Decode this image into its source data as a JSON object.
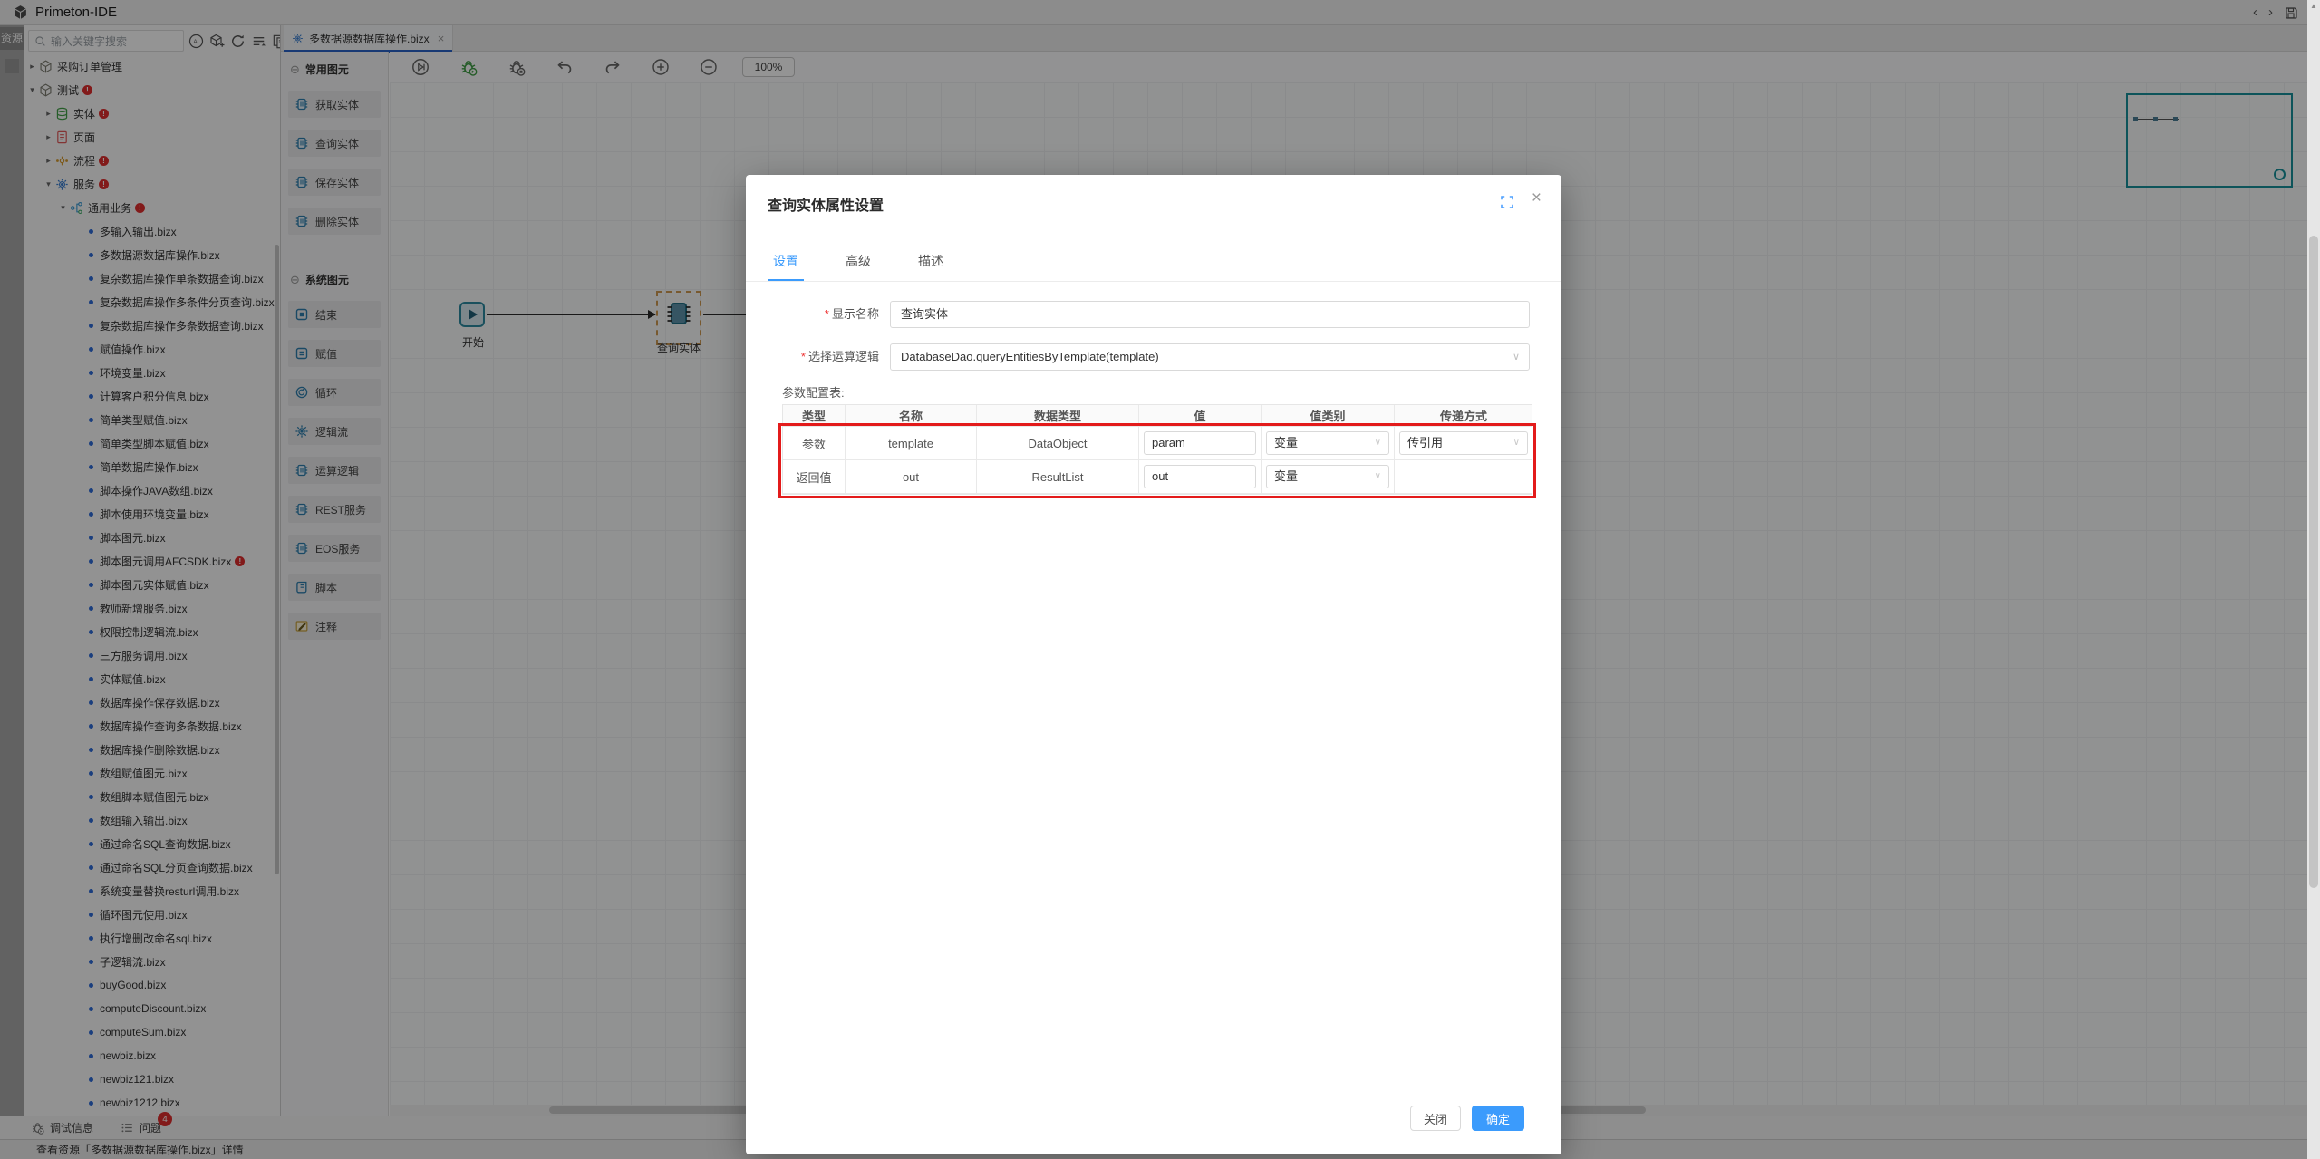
{
  "colors": {
    "accent_blue": "#3b9bfc",
    "danger_red": "#e02d2d",
    "highlight_red": "#e31b1b",
    "teal": "#18929b",
    "file_dot_blue": "#2e6cd9",
    "tab_underline_blue": "#2a62c9"
  },
  "app": {
    "title": "Primeton-IDE"
  },
  "window_controls": [
    "back",
    "forward",
    "save"
  ],
  "activity_bar": {
    "label": "资源"
  },
  "explorer": {
    "search": {
      "placeholder": "输入关键字搜索",
      "icons": [
        "ai",
        "new-model",
        "refresh",
        "outline",
        "documents"
      ]
    },
    "tree": [
      {
        "indent": 0,
        "expanded": false,
        "icon": "package",
        "label": "采购订单管理",
        "badge": false
      },
      {
        "indent": 0,
        "expanded": true,
        "icon": "package",
        "label": "测试",
        "badge": true
      },
      {
        "indent": 1,
        "expanded": false,
        "icon": "entity",
        "label": "实体",
        "badge": true
      },
      {
        "indent": 1,
        "expanded": false,
        "icon": "page",
        "label": "页面",
        "badge": false
      },
      {
        "indent": 1,
        "expanded": false,
        "icon": "process",
        "label": "流程",
        "badge": true
      },
      {
        "indent": 1,
        "expanded": true,
        "icon": "service",
        "label": "服务",
        "badge": true
      },
      {
        "indent": 2,
        "expanded": true,
        "icon": "branch",
        "label": "通用业务",
        "badge": true
      }
    ],
    "files": [
      "多输入输出.bizx",
      "多数据源数据库操作.bizx",
      "复杂数据库操作单条数据查询.bizx",
      "复杂数据库操作多条件分页查询.bizx",
      "复杂数据库操作多条数据查询.bizx",
      "赋值操作.bizx",
      "环境变量.bizx",
      "计算客户积分信息.bizx",
      "简单类型赋值.bizx",
      "简单类型脚本赋值.bizx",
      "简单数据库操作.bizx",
      "脚本操作JAVA数组.bizx",
      "脚本使用环境变量.bizx",
      "脚本图元.bizx",
      "脚本图元调用AFCSDK.bizx",
      "脚本图元实体赋值.bizx",
      "教师新增服务.bizx",
      "权限控制逻辑流.bizx",
      "三方服务调用.bizx",
      "实体赋值.bizx",
      "数据库操作保存数据.bizx",
      "数据库操作查询多条数据.bizx",
      "数据库操作删除数据.bizx",
      "数组赋值图元.bizx",
      "数组脚本赋值图元.bizx",
      "数组输入输出.bizx",
      "通过命名SQL查询数据.bizx",
      "通过命名SQL分页查询数据.bizx",
      "系统变量替换resturl调用.bizx",
      "循环图元使用.bizx",
      "执行增删改命名sql.bizx",
      "子逻辑流.bizx",
      "buyGood.bizx",
      "computeDiscount.bizx",
      "computeSum.bizx",
      "newbiz.bizx",
      "newbiz121.bizx",
      "newbiz1212.bizx"
    ],
    "badged_files": [
      "脚本图元调用AFCSDK.bizx"
    ]
  },
  "editor": {
    "tab": {
      "label": "多数据源数据库操作.bizx"
    },
    "palette": {
      "sections": [
        {
          "title": "常用图元",
          "items": [
            {
              "label": "获取实体",
              "icon": "chip"
            },
            {
              "label": "查询实体",
              "icon": "chip"
            },
            {
              "label": "保存实体",
              "icon": "chip"
            },
            {
              "label": "删除实体",
              "icon": "chip"
            }
          ]
        },
        {
          "title": "系统图元",
          "items": [
            {
              "label": "结束",
              "icon": "end"
            },
            {
              "label": "赋值",
              "icon": "assign"
            },
            {
              "label": "循环",
              "icon": "loop"
            },
            {
              "label": "逻辑流",
              "icon": "gear"
            },
            {
              "label": "运算逻辑",
              "icon": "chip"
            },
            {
              "label": "REST服务",
              "icon": "chip"
            },
            {
              "label": "EOS服务",
              "icon": "chip"
            },
            {
              "label": "脚本",
              "icon": "script"
            },
            {
              "label": "注释",
              "icon": "comment"
            }
          ]
        }
      ]
    },
    "toolbar": {
      "icons": [
        "run",
        "debug",
        "stop-debug",
        "undo",
        "redo",
        "zoom-in",
        "zoom-out"
      ],
      "zoom_level": "100%"
    },
    "canvas": {
      "nodes": [
        {
          "label": "开始",
          "selected": false
        },
        {
          "label": "查询实体",
          "selected": true
        }
      ]
    }
  },
  "dialog": {
    "title": "查询实体属性设置",
    "tabs": [
      {
        "label": "设置",
        "active": true
      },
      {
        "label": "高级",
        "active": false
      },
      {
        "label": "描述",
        "active": false
      }
    ],
    "fields": [
      {
        "label": "显示名称",
        "required": true,
        "value": "查询实体",
        "type": "input"
      },
      {
        "label": "选择运算逻辑",
        "required": true,
        "value": "DatabaseDao.queryEntitiesByTemplate(template)",
        "type": "select"
      }
    ],
    "table": {
      "caption": "参数配置表:",
      "headers": [
        "类型",
        "名称",
        "数据类型",
        "值",
        "值类别",
        "传递方式"
      ],
      "rows": [
        {
          "type": "参数",
          "name": "template",
          "data_type": "DataObject",
          "value": "param",
          "value_category": "变量",
          "pass_mode": "传引用"
        },
        {
          "type": "返回值",
          "name": "out",
          "data_type": "ResultList",
          "value": "out",
          "value_category": "变量",
          "pass_mode": ""
        }
      ]
    },
    "buttons": {
      "close": "关闭",
      "ok": "确定"
    }
  },
  "bottom_bar": {
    "tabs": [
      {
        "label": "调试信息",
        "badge": ""
      },
      {
        "label": "问题",
        "badge": "4"
      }
    ]
  },
  "status_bar": {
    "text": "查看资源「多数据源数据库操作.bizx」详情"
  }
}
